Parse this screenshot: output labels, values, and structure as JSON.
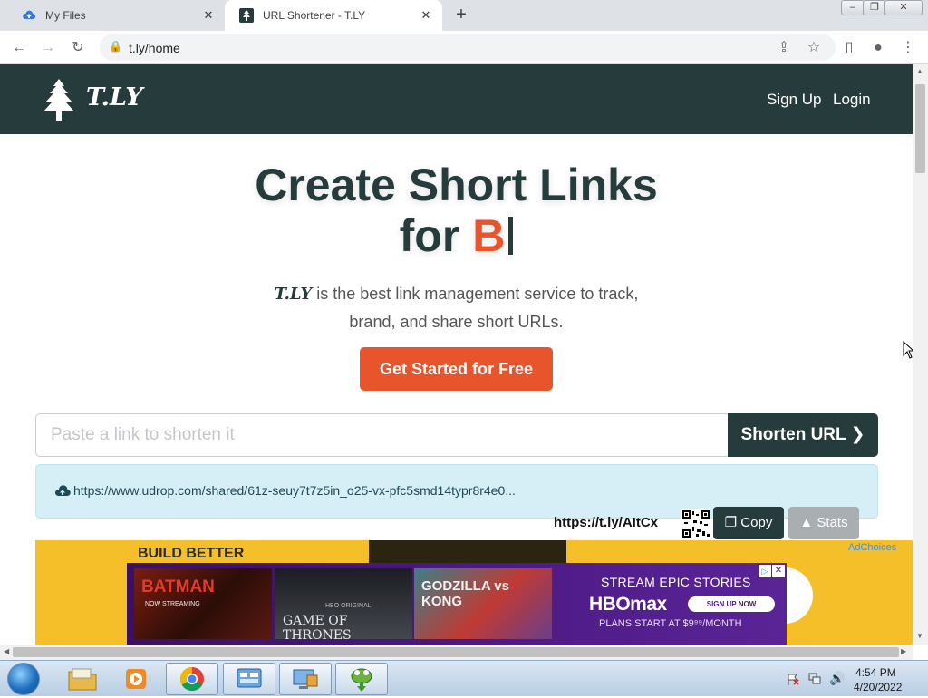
{
  "browser": {
    "tabs": [
      {
        "title": "My Files"
      },
      {
        "title": "URL Shortener - T.LY"
      }
    ],
    "address": "t.ly/home"
  },
  "site": {
    "logo_text": "T.LY",
    "nav": {
      "signup": "Sign Up",
      "login": "Login"
    },
    "hero": {
      "title_line1": "Create Short Links",
      "title_prefix": "for",
      "typed_text": "B",
      "sub_brand": "T.LY",
      "sub_line1_rest": " is the best link management service to track,",
      "sub_line2": "brand, and share short URLs.",
      "cta": "Get Started for Free"
    },
    "shortener": {
      "placeholder": "Paste a link to shorten it",
      "value": "",
      "button": "Shorten URL"
    },
    "result": {
      "long_url": "https://www.udrop.com/shared/61z-seuy7t7z5in_o25-vx-pfc5smd14typr8r4e0...",
      "short_url": "https://t.ly/AItCx",
      "copy": "Copy",
      "stats": "Stats"
    },
    "ad": {
      "headline": "BUILD BETTER",
      "adchoices": "AdChoices",
      "hbo": {
        "tile1": "BATMAN",
        "tile1_sub": "NOW STREAMING",
        "tile2": "GAME OF THRONES",
        "tile2_sub": "HBO ORIGINAL",
        "tile3": "GODZILLA vs KONG",
        "epic": "STREAM EPIC STORIES",
        "logo": "HBOmax",
        "signup": "SIGN UP NOW",
        "plans": "PLANS START AT $9⁹⁹/MONTH"
      }
    }
  },
  "taskbar": {
    "time": "4:54 PM",
    "date": "4/20/2022"
  },
  "colors": {
    "brand_dark": "#263b3b",
    "accent_orange": "#e8542c",
    "result_bg": "#d6eef5"
  }
}
